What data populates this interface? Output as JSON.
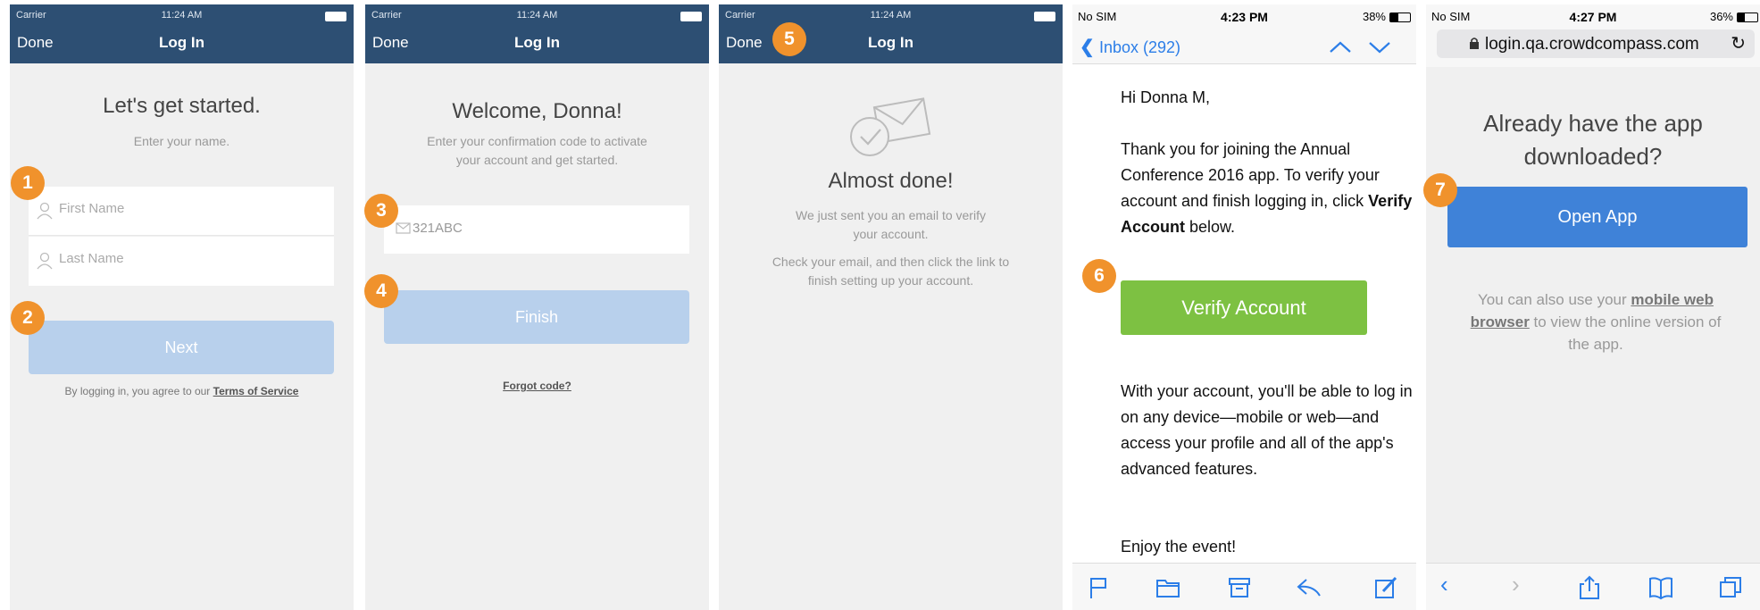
{
  "screen1": {
    "status": {
      "carrier": "Carrier",
      "time": "11:24 AM"
    },
    "nav": {
      "done": "Done",
      "title": "Log In"
    },
    "heading": "Let's get started.",
    "subheading": "Enter your name.",
    "first_name_placeholder": "First Name",
    "last_name_placeholder": "Last Name",
    "next_label": "Next",
    "terms_prefix": "By logging in, you agree to our",
    "terms_link": "Terms of Service",
    "badge1": "1",
    "badge2": "2"
  },
  "screen2": {
    "status": {
      "carrier": "Carrier",
      "time": "11:24 AM"
    },
    "nav": {
      "done": "Done",
      "title": "Log In"
    },
    "heading": "Welcome, Donna!",
    "subheading_line1": "Enter your confirmation code to activate",
    "subheading_line2": "your account and get started.",
    "code_value": "321ABC",
    "finish_label": "Finish",
    "forgot_label": "Forgot code?",
    "badge3": "3",
    "badge4": "4"
  },
  "screen3": {
    "status": {
      "carrier": "Carrier",
      "time": "11:24 AM"
    },
    "nav": {
      "done": "Done",
      "title": "Log In"
    },
    "heading": "Almost done!",
    "line1": "We just sent you an email to verify",
    "line2": "your account.",
    "line3": "Check your email, and then click the link to",
    "line4": "finish setting up your account.",
    "badge5": "5"
  },
  "screen4": {
    "status": {
      "carrier": "No SIM",
      "time": "4:23 PM",
      "battery": "38%"
    },
    "back_label": "Inbox (292)",
    "greeting": "Hi Donna M,",
    "para1_a": "Thank you for joining the Annual Conference 2016 app. To verify your account and finish logging in, click ",
    "para1_bold": "Verify Account",
    "para1_b": " below.",
    "verify_label": "Verify Account",
    "para2": "With your account, you'll be able to log in on any device—mobile or web—and access your profile and all of the app's advanced features.",
    "closing": "Enjoy the event!",
    "badge6": "6",
    "colors": {
      "verify": "#7dc142"
    }
  },
  "screen5": {
    "status": {
      "carrier": "No SIM",
      "time": "4:27 PM",
      "battery": "36%"
    },
    "url": "login.qa.crowdcompass.com",
    "heading_line1": "Already have the app",
    "heading_line2": "downloaded?",
    "open_label": "Open App",
    "text_a": "You can also use your ",
    "text_link": "mobile web browser",
    "text_b": " to view the online version of the app.",
    "badge7": "7",
    "colors": {
      "open": "#3f82d8"
    }
  },
  "colors": {
    "navbar": "#2d4f73",
    "badge": "#f0922c",
    "disabled_button": "#b8d0ec"
  }
}
